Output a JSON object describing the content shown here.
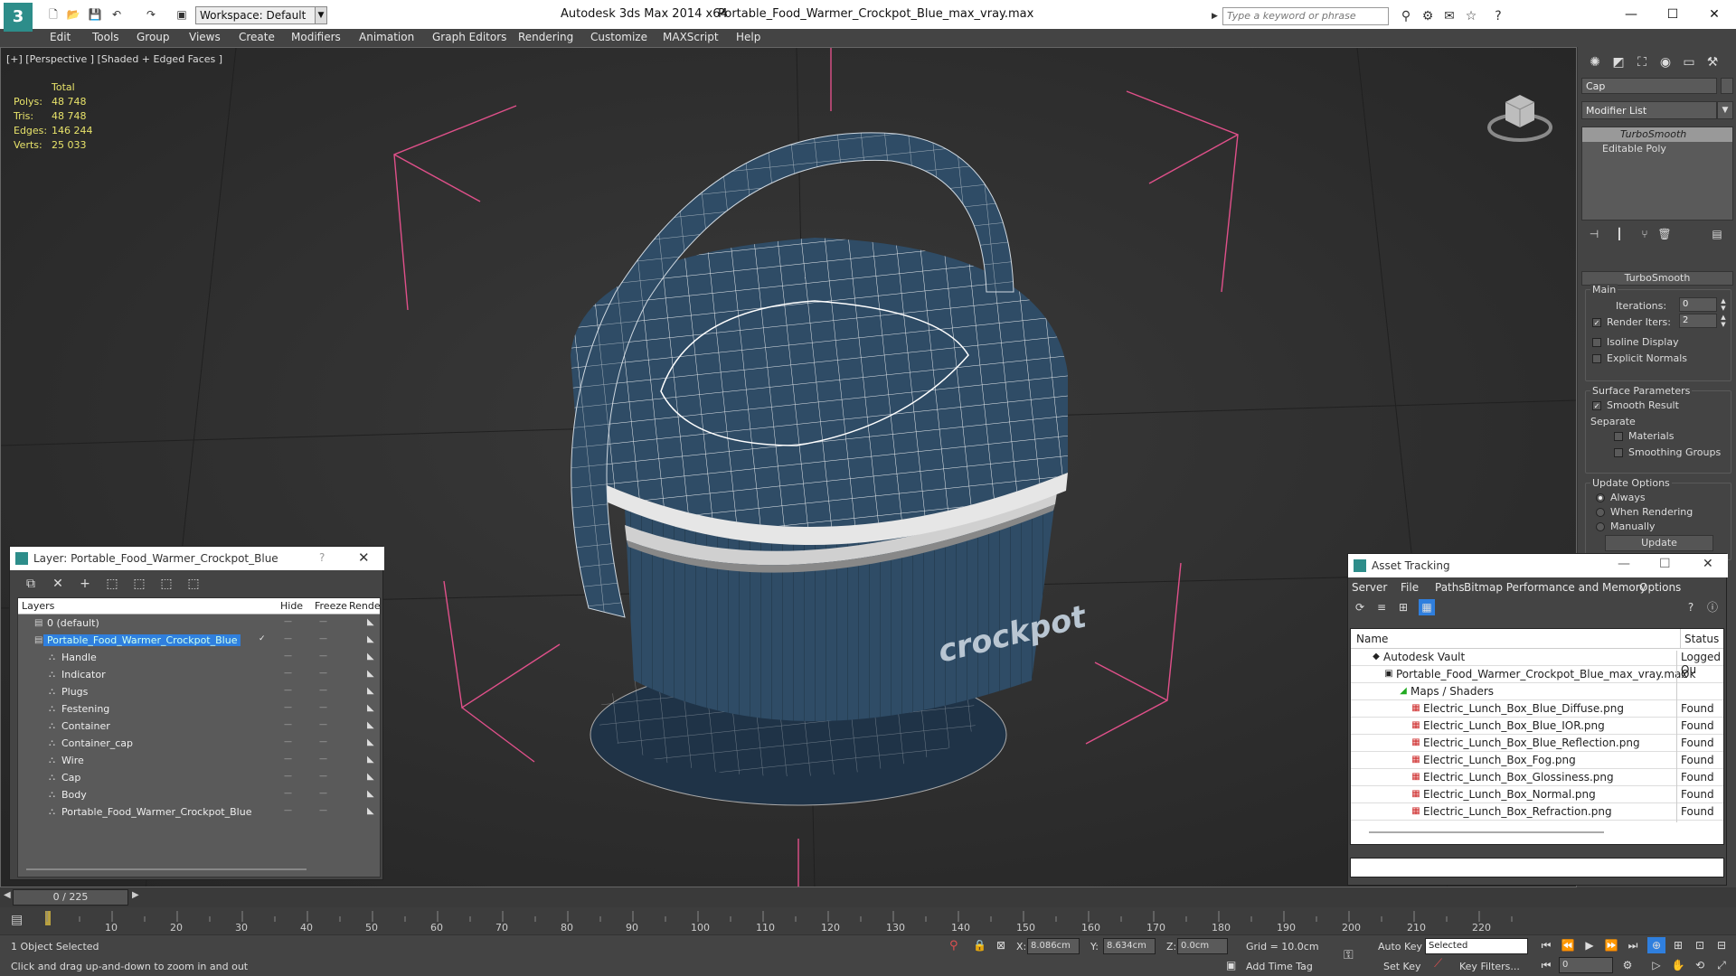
{
  "titlebar": {
    "workspace": "Workspace: Default",
    "app_title": "Autodesk 3ds Max  2014 x64",
    "file_title": "Portable_Food_Warmer_Crockpot_Blue_max_vray.max",
    "search_placeholder": "Type a keyword or phrase"
  },
  "menu": [
    "Edit",
    "Tools",
    "Group",
    "Views",
    "Create",
    "Modifiers",
    "Animation",
    "Graph Editors",
    "Rendering",
    "Customize",
    "MAXScript",
    "Help"
  ],
  "viewport": {
    "label": "[+] [Perspective ] [Shaded + Edged Faces ]",
    "stats_header": "Total",
    "stats": [
      {
        "k": "Polys:",
        "v": "48 748"
      },
      {
        "k": "Tris:",
        "v": "48 748"
      },
      {
        "k": "Edges:",
        "v": "146 244"
      },
      {
        "k": "Verts:",
        "v": "25 033"
      }
    ],
    "logo_text": "crockpot"
  },
  "command_panel": {
    "object_name": "Cap",
    "modifier_list": "Modifier List",
    "stack": [
      "TurboSmooth",
      "Editable Poly"
    ],
    "rollout": "TurboSmooth",
    "main_group": "Main",
    "iterations_label": "Iterations:",
    "iterations_value": "0",
    "render_iters_label": "Render Iters:",
    "render_iters_value": "2",
    "isoline": "Isoline Display",
    "explicit_normals": "Explicit Normals",
    "surface_params": "Surface Parameters",
    "smooth_result": "Smooth Result",
    "separate": "Separate",
    "materials": "Materials",
    "smoothing_groups": "Smoothing Groups",
    "update_options": "Update Options",
    "always": "Always",
    "when_rendering": "When Rendering",
    "manually": "Manually",
    "update_button": "Update"
  },
  "layer_dialog": {
    "title": "Layer: Portable_Food_Warmer_Crockpot_Blue",
    "help": "?",
    "columns": [
      "Layers",
      "Hide",
      "Freeze",
      "Render"
    ],
    "rows": [
      {
        "name": "0 (default)",
        "indent": 0
      },
      {
        "name": "Portable_Food_Warmer_Crockpot_Blue",
        "indent": 0,
        "selected": true
      },
      {
        "name": "Handle",
        "indent": 1
      },
      {
        "name": "Indicator",
        "indent": 1
      },
      {
        "name": "Plugs",
        "indent": 1
      },
      {
        "name": "Festening",
        "indent": 1
      },
      {
        "name": "Container",
        "indent": 1
      },
      {
        "name": "Container_cap",
        "indent": 1
      },
      {
        "name": "Wire",
        "indent": 1
      },
      {
        "name": "Cap",
        "indent": 1
      },
      {
        "name": "Body",
        "indent": 1
      },
      {
        "name": "Portable_Food_Warmer_Crockpot_Blue",
        "indent": 1
      }
    ]
  },
  "asset_dialog": {
    "title": "Asset Tracking",
    "menu": [
      "Server",
      "File",
      "Paths",
      "Bitmap Performance and Memory",
      "Options"
    ],
    "columns": [
      "Name",
      "Status"
    ],
    "rows": [
      {
        "name": "Autodesk Vault",
        "status": "Logged Ou",
        "level": 0
      },
      {
        "name": "Portable_Food_Warmer_Crockpot_Blue_max_vray.max",
        "status": "Ok",
        "level": 1
      },
      {
        "name": "Maps / Shaders",
        "status": "",
        "level": 2
      },
      {
        "name": "Electric_Lunch_Box_Blue_Diffuse.png",
        "status": "Found",
        "level": 3
      },
      {
        "name": "Electric_Lunch_Box_Blue_IOR.png",
        "status": "Found",
        "level": 3
      },
      {
        "name": "Electric_Lunch_Box_Blue_Reflection.png",
        "status": "Found",
        "level": 3
      },
      {
        "name": "Electric_Lunch_Box_Fog.png",
        "status": "Found",
        "level": 3
      },
      {
        "name": "Electric_Lunch_Box_Glossiness.png",
        "status": "Found",
        "level": 3
      },
      {
        "name": "Electric_Lunch_Box_Normal.png",
        "status": "Found",
        "level": 3
      },
      {
        "name": "Electric_Lunch_Box_Refraction.png",
        "status": "Found",
        "level": 3
      }
    ]
  },
  "timeline": {
    "frame": "0 / 225",
    "ticks": [
      "10",
      "20",
      "30",
      "40",
      "50",
      "60",
      "70",
      "80",
      "90",
      "100",
      "110",
      "120",
      "130",
      "140",
      "150",
      "160",
      "170",
      "180",
      "190",
      "200",
      "210",
      "220"
    ]
  },
  "status": {
    "selection": "1 Object Selected",
    "prompt": "Click and drag up-and-down to zoom in and out",
    "x_label": "X:",
    "x_value": "8.086cm",
    "y_label": "Y:",
    "y_value": "8.634cm",
    "z_label": "Z:",
    "z_value": "0.0cm",
    "grid": "Grid = 10.0cm",
    "auto_key": "Auto Key",
    "selected": "Selected",
    "set_key": "Set Key",
    "key_filters": "Key Filters...",
    "add_time_tag": "Add Time Tag",
    "frame_field": "0"
  },
  "colors": {
    "mesh": "#2f4c66",
    "wire": "#ffffff",
    "selection": "#2f7fde",
    "gizmo": "#e0508a",
    "stats": "#e8e36a"
  }
}
